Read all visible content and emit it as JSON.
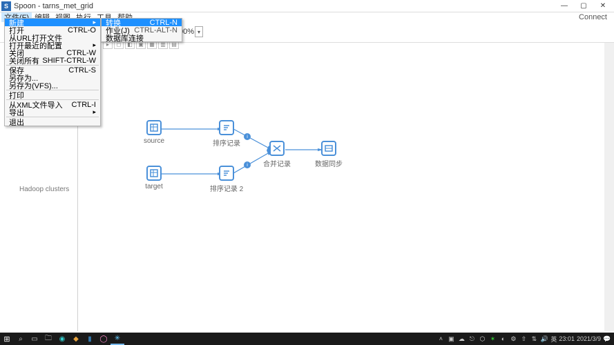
{
  "title": "Spoon - tarns_met_grid",
  "menubar": {
    "file": "文件(F)",
    "edit": "编辑",
    "view": "视图",
    "execute": "执行",
    "tools": "工具",
    "help": "帮助",
    "connect": "Connect"
  },
  "fileMenu": {
    "new": "新建",
    "open": "打开",
    "open_sc": "CTRL-O",
    "openUrl": "从URL打开文件",
    "openRecent": "打开最近的配置",
    "close": "关闭",
    "close_sc": "CTRL-W",
    "closeAll": "关闭所有",
    "closeAll_sc": "SHIFT-CTRL-W",
    "save": "保存",
    "save_sc": "CTRL-S",
    "saveAs": "另存为...",
    "saveVfs": "另存为(VFS)...",
    "print": "打印",
    "importXml": "从XML文件导入",
    "importXml_sc": "CTRL-I",
    "export": "导出",
    "exit": "退出"
  },
  "newSubmenu": {
    "trans": "转换",
    "trans_sc": "CTRL-N",
    "job": "作业(J)",
    "job_sc": "CTRL-ALT-N",
    "dbconn": "数据库连接"
  },
  "toolbar": {
    "zoom": "100%"
  },
  "sidebar": {
    "hadoop": "Hadoop clusters"
  },
  "nodes": {
    "source": "source",
    "target": "target",
    "sort1": "排序记录",
    "sort2": "排序记录 2",
    "merge": "合并记录",
    "sync": "数据同步"
  },
  "tray": {
    "lang": "英",
    "time": "23:01",
    "date": "2021/3/9"
  }
}
